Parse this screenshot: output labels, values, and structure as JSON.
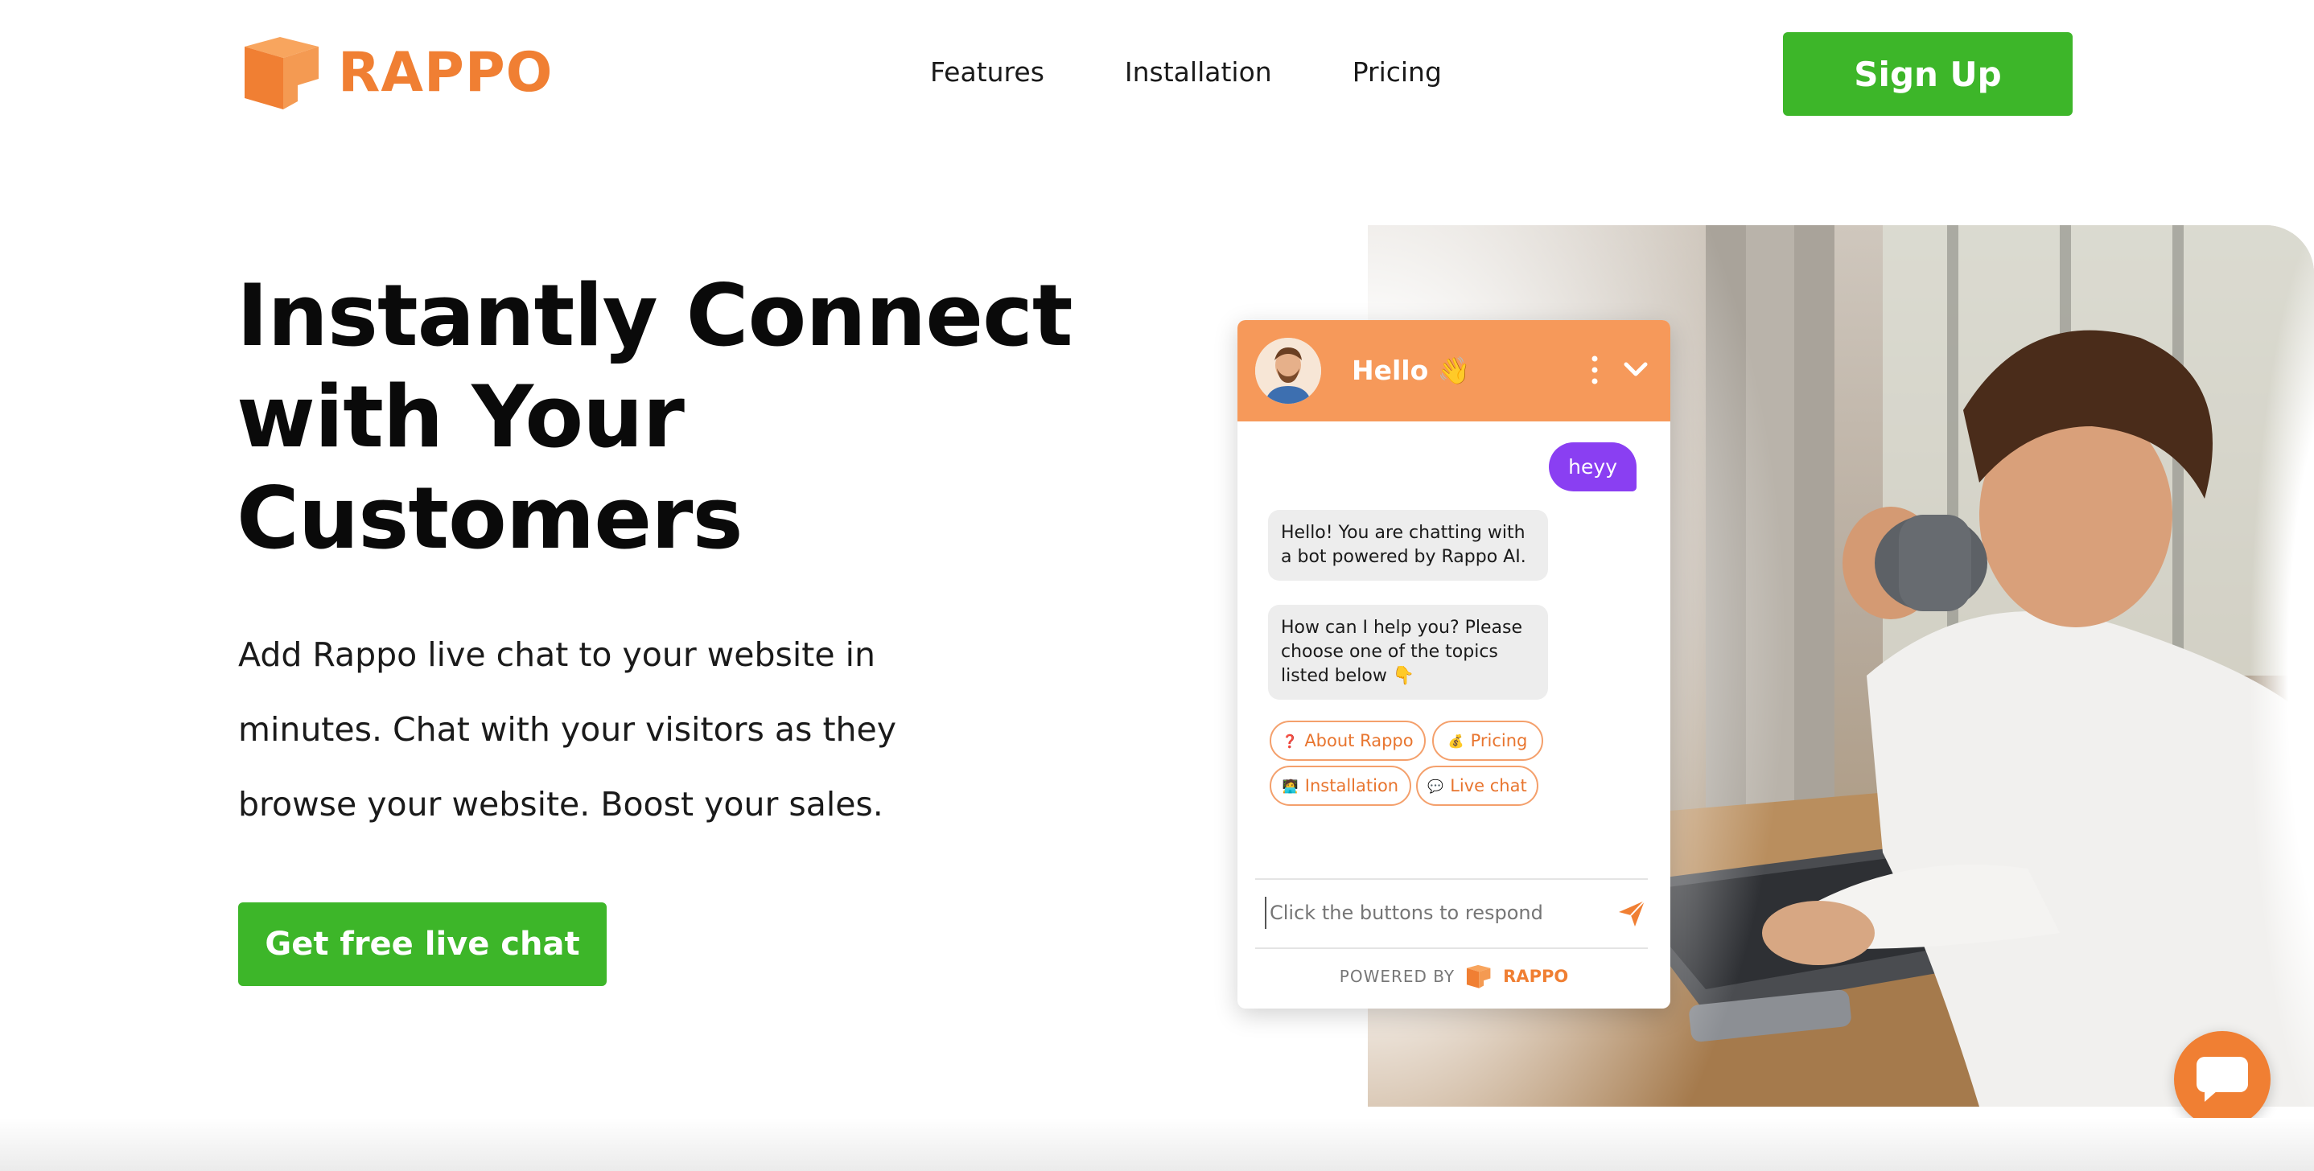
{
  "brand": {
    "name": "RAPPO",
    "color": "#f07f33"
  },
  "nav": {
    "items": [
      {
        "label": "Features"
      },
      {
        "label": "Installation"
      },
      {
        "label": "Pricing"
      }
    ],
    "signup_label": "Sign Up"
  },
  "hero": {
    "title_lines": [
      "Instantly Connect",
      "with Your",
      "Customers"
    ],
    "subtitle_lines": [
      "Add Rappo live chat to your website in",
      "minutes. Chat with your visitors as they",
      "browse your website. Boost your sales."
    ],
    "cta_label": "Get free live chat"
  },
  "chat": {
    "header_title": "Hello 👋",
    "messages": [
      {
        "from": "user",
        "text": "heyy"
      },
      {
        "from": "bot",
        "text": "Hello! You are chatting with a bot powered by Rappo AI."
      },
      {
        "from": "bot",
        "text": "How can I help you? Please choose one of the topics listed below 👇"
      }
    ],
    "chips": [
      {
        "icon": "❓",
        "label": "About Rappo"
      },
      {
        "icon": "💰",
        "label": "Pricing"
      },
      {
        "icon": "🧑‍💻",
        "label": "Installation"
      },
      {
        "icon": "💬",
        "label": "Live chat"
      }
    ],
    "input_placeholder": "Click the buttons to respond",
    "powered_by": "POWERED BY",
    "powered_brand": "RAPPO"
  },
  "colors": {
    "accent_orange": "#f07f33",
    "chat_header": "#f6995a",
    "user_bubble": "#8a3ff2",
    "cta_green": "#3db629"
  }
}
